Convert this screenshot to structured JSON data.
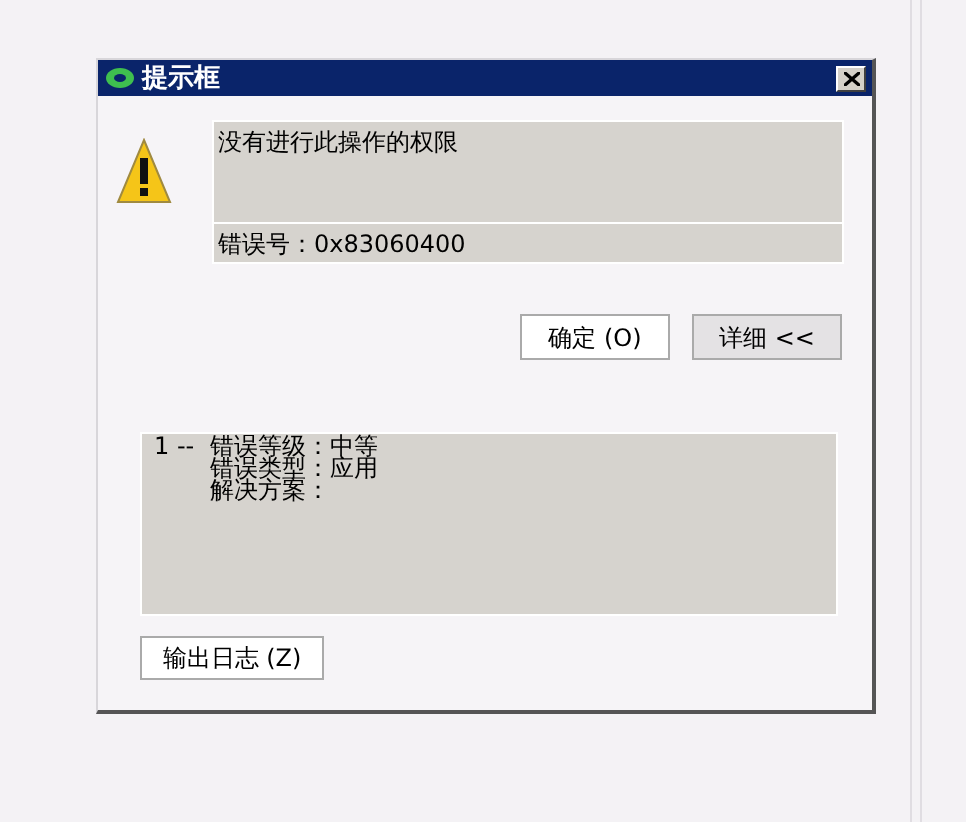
{
  "window": {
    "title": "提示框"
  },
  "message": {
    "text": "没有进行此操作的权限",
    "error_code": "错误号：0x83060400"
  },
  "buttons": [
    {
      "label": "确定 (O)",
      "kind": "plain"
    },
    {
      "label": "详细 <<",
      "kind": "pressed"
    }
  ],
  "details": [
    {
      "index": "1 --",
      "lines": [
        "错误等级：中等",
        "错误类型：应用",
        "解决方案："
      ]
    }
  ],
  "export_button": {
    "label": "输出日志 (Z)"
  }
}
